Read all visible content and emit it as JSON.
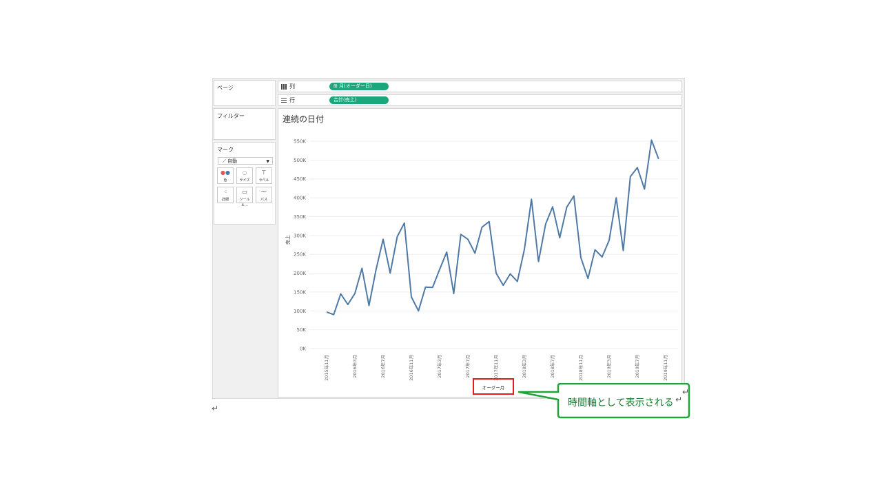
{
  "panels": {
    "pages_title": "ページ",
    "filters_title": "フィルター",
    "marks_title": "マーク",
    "mark_type": "自動",
    "mark_buttons": [
      {
        "label": "色",
        "icon": "color-dots-icon"
      },
      {
        "label": "サイズ",
        "icon": "size-icon"
      },
      {
        "label": "ラベル",
        "icon": "label-icon"
      },
      {
        "label": "詳細",
        "icon": "detail-icon"
      },
      {
        "label": "ツールヒ…",
        "icon": "tooltip-icon"
      },
      {
        "label": "パス",
        "icon": "path-icon"
      }
    ]
  },
  "shelves": {
    "columns_label": "列",
    "columns_pill": "⊞ 月(オーダー日)",
    "rows_label": "行",
    "rows_pill": "合計(売上)"
  },
  "colors": {
    "pill": "#1ba67c",
    "line": "#4e79a7",
    "highlight_box": "#e21a1a",
    "callout_border": "#22a33a",
    "callout_text": "#1a7a2f"
  },
  "chart_data": {
    "type": "line",
    "title": "連続の日付",
    "xlabel": "オーダー月",
    "ylabel": "売上",
    "ylim": [
      0,
      550000
    ],
    "yticks": [
      0,
      50000,
      100000,
      150000,
      200000,
      250000,
      300000,
      350000,
      400000,
      450000,
      500000,
      550000
    ],
    "ytick_labels": [
      "0K",
      "50K",
      "100K",
      "150K",
      "200K",
      "250K",
      "300K",
      "350K",
      "400K",
      "450K",
      "500K",
      "550K"
    ],
    "grid": true,
    "xtick_labels": [
      "2015年11月",
      "2016年3月",
      "2016年7月",
      "2016年11月",
      "2017年3月",
      "2017年7月",
      "2017年11月",
      "2018年3月",
      "2018年7月",
      "2018年11月",
      "2019年3月",
      "2019年7月",
      "2019年11月"
    ],
    "x": [
      "2015-11",
      "2015-12",
      "2016-01",
      "2016-02",
      "2016-03",
      "2016-04",
      "2016-05",
      "2016-06",
      "2016-07",
      "2016-08",
      "2016-09",
      "2016-10",
      "2016-11",
      "2016-12",
      "2017-01",
      "2017-02",
      "2017-03",
      "2017-04",
      "2017-05",
      "2017-06",
      "2017-07",
      "2017-08",
      "2017-09",
      "2017-10",
      "2017-11",
      "2017-12",
      "2018-01",
      "2018-02",
      "2018-03",
      "2018-04",
      "2018-05",
      "2018-06",
      "2018-07",
      "2018-08",
      "2018-09",
      "2018-10",
      "2018-11",
      "2018-12",
      "2019-01",
      "2019-02",
      "2019-03",
      "2019-04",
      "2019-05",
      "2019-06",
      "2019-07",
      "2019-08",
      "2019-09",
      "2019-10",
      "2019-11",
      "2019-12"
    ],
    "series": [
      {
        "values": [
          97000,
          90000,
          145000,
          117000,
          146000,
          213000,
          114000,
          210000,
          290000,
          200000,
          297000,
          333000,
          137000,
          100000,
          163000,
          162000,
          210000,
          256000,
          146000,
          303000,
          290000,
          253000,
          322000,
          337000,
          200000,
          168000,
          198000,
          178000,
          263000,
          396000,
          231000,
          330000,
          376000,
          294000,
          375000,
          405000,
          241000,
          186000,
          262000,
          243000,
          287000,
          400000,
          260000,
          456000,
          480000,
          423000,
          553000,
          503000
        ]
      }
    ]
  },
  "annotation": {
    "callout_text": "時間軸として表示される"
  }
}
